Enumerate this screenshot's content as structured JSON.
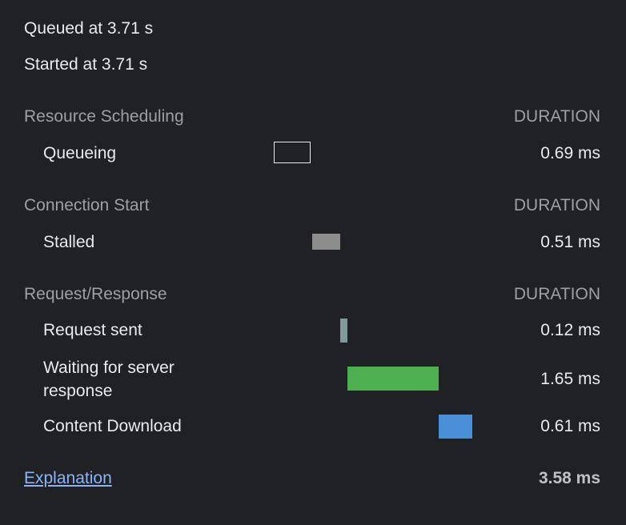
{
  "queued": "Queued at 3.71 s",
  "started": "Started at 3.71 s",
  "sections": [
    {
      "title": "Resource Scheduling",
      "duration_header": "DURATION",
      "rows": [
        {
          "label": "Queueing",
          "value": "0.69 ms",
          "bar_style": "outline",
          "bar_color": "#e8eaed"
        }
      ]
    },
    {
      "title": "Connection Start",
      "duration_header": "DURATION",
      "rows": [
        {
          "label": "Stalled",
          "value": "0.51 ms",
          "bar_style": "fill",
          "bar_color": "#8c8c8c"
        }
      ]
    },
    {
      "title": "Request/Response",
      "duration_header": "DURATION",
      "rows": [
        {
          "label": "Request sent",
          "value": "0.12 ms",
          "bar_style": "fill",
          "bar_color": "#7f9a9a"
        },
        {
          "label": "Waiting for server response",
          "value": "1.65 ms",
          "bar_style": "fill",
          "bar_color": "#4caf50"
        },
        {
          "label": "Content Download",
          "value": "0.61 ms",
          "bar_style": "fill",
          "bar_color": "#4a90d9"
        }
      ]
    }
  ],
  "explanation_link": "Explanation",
  "total": "3.58 ms"
}
